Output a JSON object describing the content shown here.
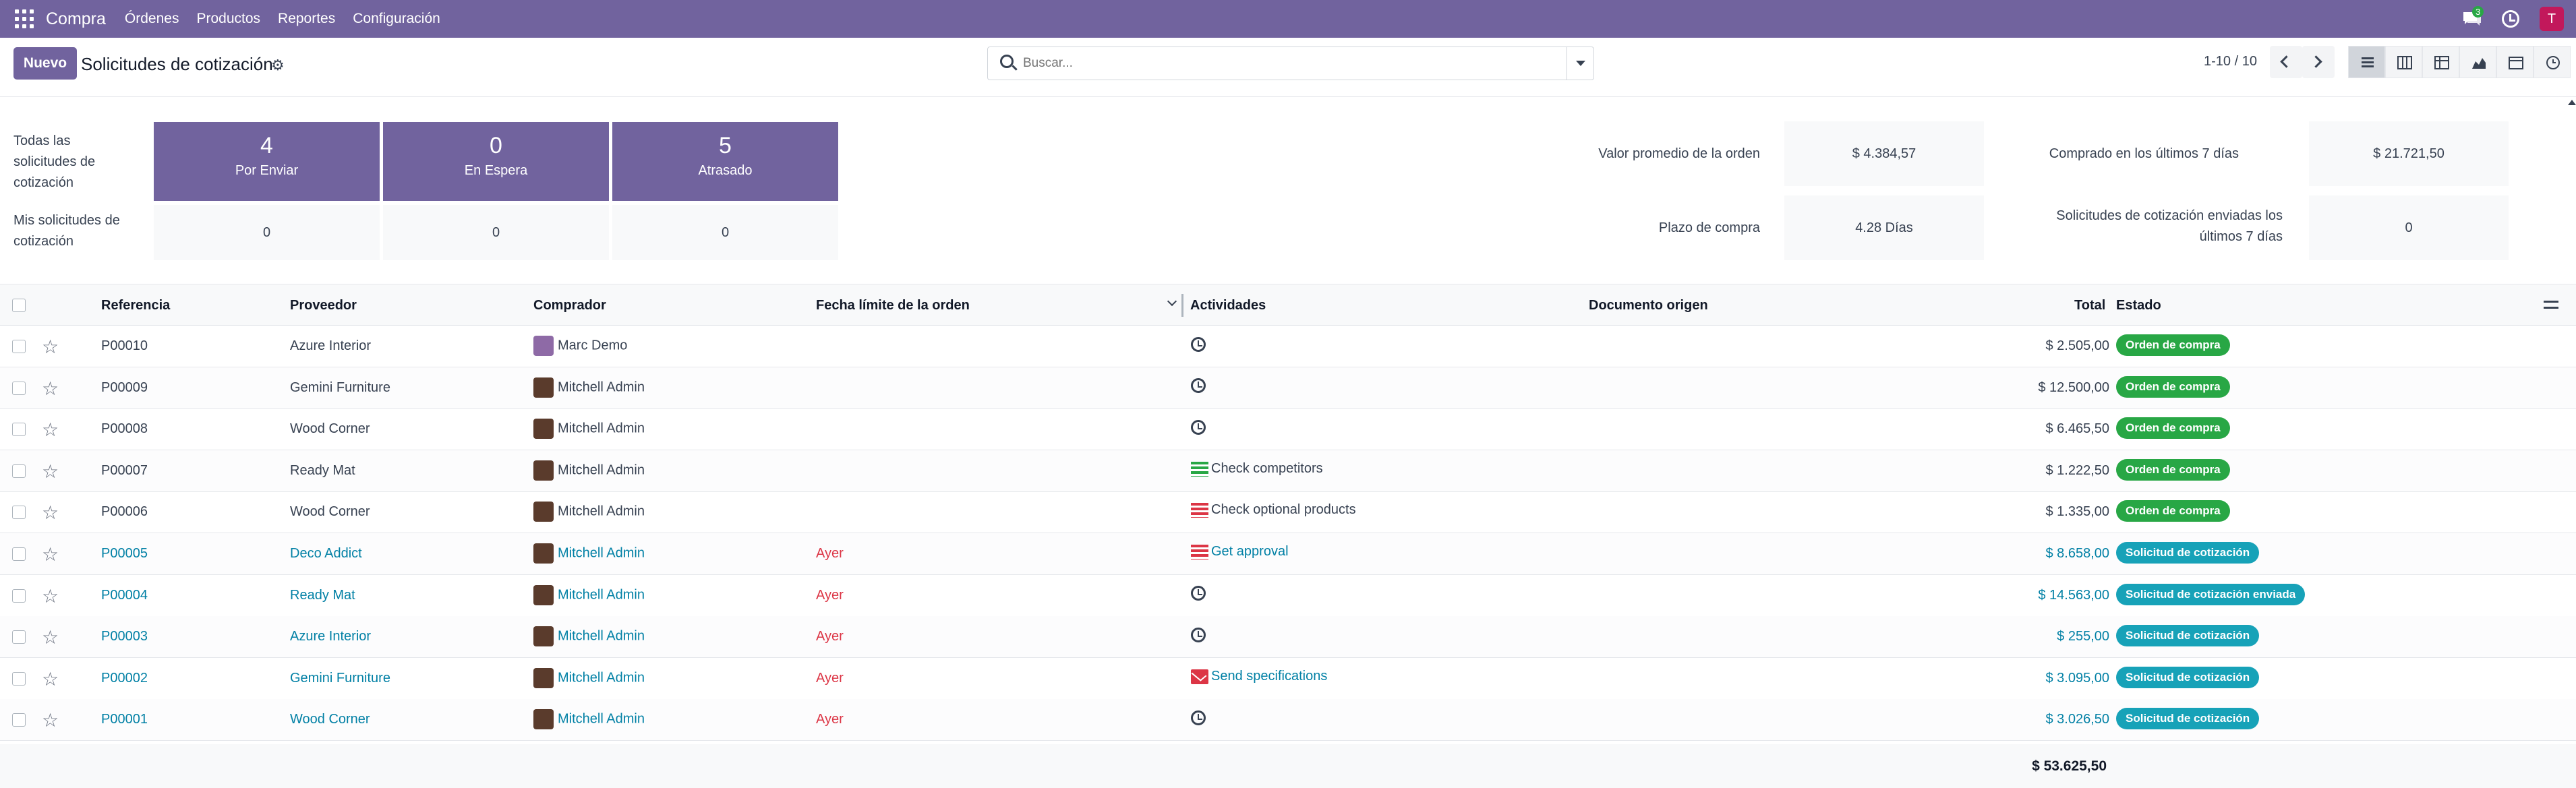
{
  "app": {
    "name": "Compra",
    "menus": [
      "Órdenes",
      "Productos",
      "Reportes",
      "Configuración"
    ],
    "messages_count": "3",
    "user_initial": "T"
  },
  "control": {
    "new_label": "Nuevo",
    "title": "Solicitudes de cotización",
    "search_placeholder": "Buscar...",
    "pager": "1-10 / 10"
  },
  "dashboard": {
    "row_labels": [
      "Todas las solicitudes de cotización",
      "Mis solicitudes de cotización"
    ],
    "cards": [
      {
        "count": "4",
        "label": "Por Enviar",
        "mine": "0"
      },
      {
        "count": "0",
        "label": "En Espera",
        "mine": "0"
      },
      {
        "count": "5",
        "label": "Atrasado",
        "mine": "0"
      }
    ],
    "kpis": {
      "avg_label": "Valor promedio de la orden",
      "avg_value": "$ 4.384,57",
      "bought_label": "Comprado en los últimos 7 días",
      "bought_value": "$ 21.721,50",
      "lead_label": "Plazo de compra",
      "lead_value": "4.28 Días",
      "sent_label": "Solicitudes de cotización enviadas los últimos 7 días",
      "sent_value": "0"
    }
  },
  "table": {
    "headers": {
      "ref": "Referencia",
      "vendor": "Proveedor",
      "buyer": "Comprador",
      "deadline": "Fecha límite de la orden",
      "activities": "Actividades",
      "origin": "Documento origen",
      "total": "Total",
      "state": "Estado"
    },
    "rows": [
      {
        "ref": "P00010",
        "vendor": "Azure Interior",
        "buyer": "Marc Demo",
        "deadline": "",
        "activity": "",
        "total": "$ 2.505,00",
        "state": "Orden de compra"
      },
      {
        "ref": "P00009",
        "vendor": "Gemini Furniture",
        "buyer": "Mitchell Admin",
        "deadline": "",
        "activity": "",
        "total": "$ 12.500,00",
        "state": "Orden de compra"
      },
      {
        "ref": "P00008",
        "vendor": "Wood Corner",
        "buyer": "Mitchell Admin",
        "deadline": "",
        "activity": "",
        "total": "$ 6.465,50",
        "state": "Orden de compra"
      },
      {
        "ref": "P00007",
        "vendor": "Ready Mat",
        "buyer": "Mitchell Admin",
        "deadline": "",
        "activity": "Check competitors",
        "total": "$ 1.222,50",
        "state": "Orden de compra"
      },
      {
        "ref": "P00006",
        "vendor": "Wood Corner",
        "buyer": "Mitchell Admin",
        "deadline": "",
        "activity": "Check optional products",
        "total": "$ 1.335,00",
        "state": "Orden de compra"
      },
      {
        "ref": "P00005",
        "vendor": "Deco Addict",
        "buyer": "Mitchell Admin",
        "deadline": "Ayer",
        "activity": "Get approval",
        "total": "$ 8.658,00",
        "state": "Solicitud de cotización"
      },
      {
        "ref": "P00004",
        "vendor": "Ready Mat",
        "buyer": "Mitchell Admin",
        "deadline": "Ayer",
        "activity": "",
        "total": "$ 14.563,00",
        "state": "Solicitud de cotización enviada"
      },
      {
        "ref": "P00003",
        "vendor": "Azure Interior",
        "buyer": "Mitchell Admin",
        "deadline": "Ayer",
        "activity": "",
        "total": "$ 255,00",
        "state": "Solicitud de cotización"
      },
      {
        "ref": "P00002",
        "vendor": "Gemini Furniture",
        "buyer": "Mitchell Admin",
        "deadline": "Ayer",
        "activity": "Send specifications",
        "total": "$ 3.095,00",
        "state": "Solicitud de cotización"
      },
      {
        "ref": "P00001",
        "vendor": "Wood Corner",
        "buyer": "Mitchell Admin",
        "deadline": "Ayer",
        "activity": "",
        "total": "$ 3.026,50",
        "state": "Solicitud de cotización"
      }
    ],
    "grand_total": "$ 53.625,50"
  },
  "colors": {
    "brand": "#71639e",
    "link": "#0180a5",
    "overdue": "#dc3545",
    "po_badge": "#28a745",
    "rfq_badge": "#17a2b8"
  }
}
